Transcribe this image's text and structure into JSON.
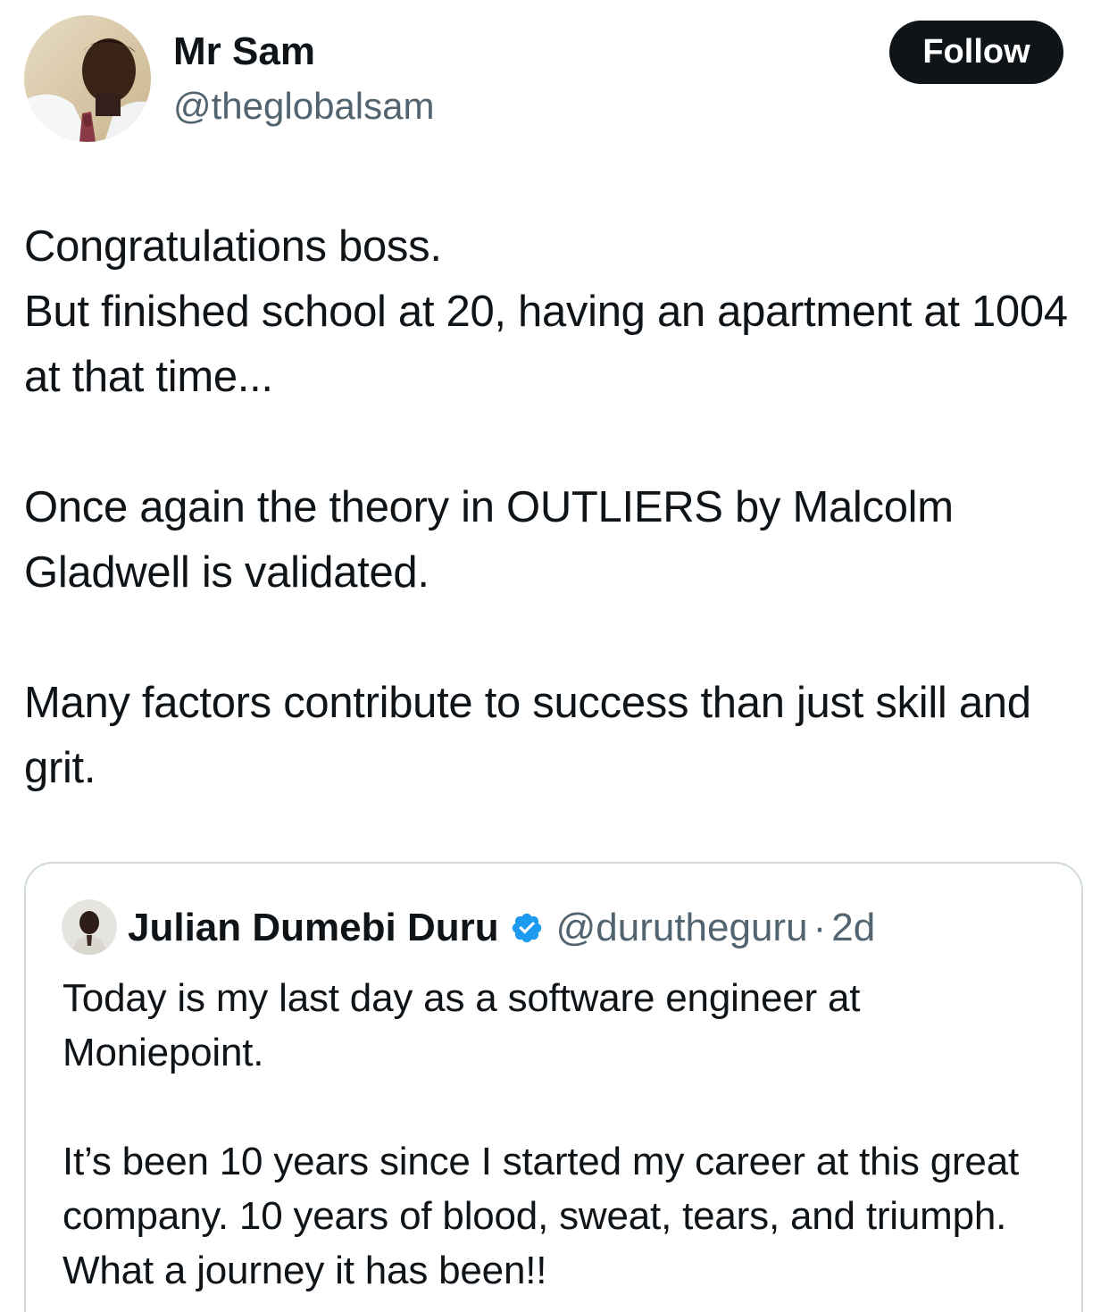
{
  "author": {
    "display_name": "Mr Sam",
    "handle": "@theglobalsam",
    "avatar_icon": "profile-photo"
  },
  "follow_button": {
    "label": "Follow"
  },
  "tweet": {
    "paragraphs": [
      "Congratulations boss.\nBut finished school at 20, having an apartment at 1004 at that time...",
      "Once again the theory in OUTLIERS by Malcolm Gladwell is validated.",
      "Many factors contribute to success than just skill and grit."
    ]
  },
  "quoted_tweet": {
    "display_name": "Julian Dumebi Duru",
    "verified_icon": "verified-badge-icon",
    "handle": "@durutheguru",
    "separator": "·",
    "time": "2d",
    "paragraphs": [
      "Today is my last day as a software engineer at Moniepoint.",
      "It’s been 10 years since I started my career at this great company. 10 years of blood, sweat, tears, and triumph. What a journey it has been!!"
    ]
  },
  "colors": {
    "text_primary": "#0f1419",
    "text_secondary": "#536471",
    "border": "#cfd9de",
    "verified_blue": "#1d9bf0",
    "follow_bg": "#0f1419"
  }
}
